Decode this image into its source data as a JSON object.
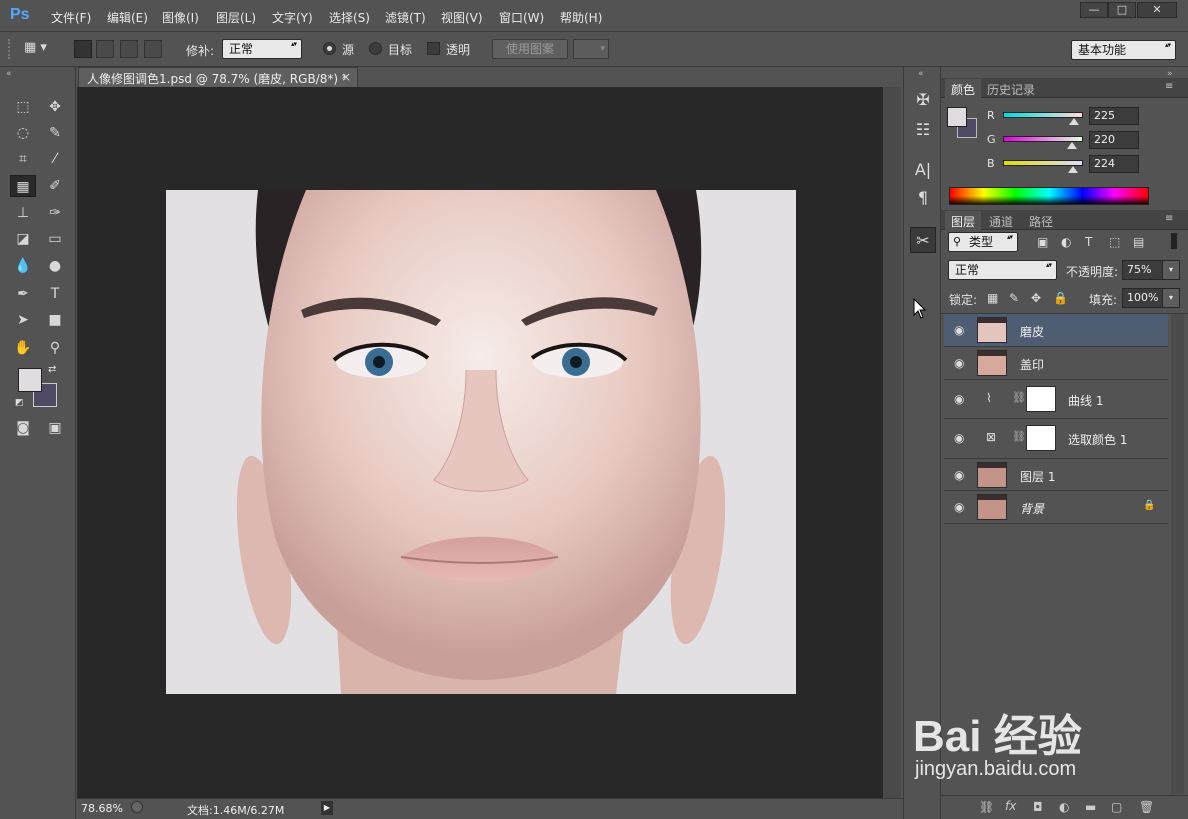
{
  "app": {
    "logo": "Ps"
  },
  "menu": [
    "文件(F)",
    "编辑(E)",
    "图像(I)",
    "图层(L)",
    "文字(Y)",
    "选择(S)",
    "滤镜(T)",
    "视图(V)",
    "窗口(W)",
    "帮助(H)"
  ],
  "window_buttons": {
    "minimize": "—",
    "maximize": "□",
    "close": "✕"
  },
  "options": {
    "patch_label": "修补:",
    "patch_mode": "正常",
    "source_label": "源",
    "target_label": "目标",
    "transparent_label": "透明",
    "use_pattern_label": "使用图案",
    "workspace": "基本功能"
  },
  "document": {
    "tab_title": "人像修图调色1.psd @ 78.7% (磨皮, RGB/8*) *",
    "close_glyph": "×",
    "zoom": "78.68%",
    "doc_size": "文档:1.46M/6.27M"
  },
  "color_panel": {
    "tabs": [
      "颜色",
      "历史记录"
    ],
    "channels": [
      {
        "label": "R",
        "value": "225",
        "fill_fraction": 0.882,
        "grad": "linear-gradient(90deg,#00dcdc,#ffdcdc)"
      },
      {
        "label": "G",
        "value": "220",
        "fill_fraction": 0.863,
        "grad": "linear-gradient(90deg,#e100e0,#e1ffe0)"
      },
      {
        "label": "B",
        "value": "224",
        "fill_fraction": 0.878,
        "grad": "linear-gradient(90deg,#e1dc00,#e1dcff)"
      }
    ],
    "fg_color": "#e1dce0",
    "bg_color": "#4e4a64"
  },
  "layers_panel": {
    "tabs": [
      "图层",
      "通道",
      "路径"
    ],
    "filter_kind": "类型",
    "blend_mode": "正常",
    "opacity_label": "不透明度:",
    "opacity": "75%",
    "lock_label": "锁定:",
    "fill_label": "填充:",
    "fill": "100%",
    "layers": [
      {
        "name": "磨皮",
        "type": "pixel",
        "selected": true
      },
      {
        "name": "盖印",
        "type": "pixel",
        "selected": false
      },
      {
        "name": "曲线 1",
        "type": "adjust-curves",
        "selected": false
      },
      {
        "name": "选取颜色 1",
        "type": "adjust-selective",
        "selected": false
      },
      {
        "name": "图层 1",
        "type": "pixel",
        "selected": false
      },
      {
        "name": "背景",
        "type": "background",
        "selected": false,
        "locked": true
      }
    ]
  },
  "watermark": {
    "brand": "Bai 经验",
    "url": "jingyan.baidu.com"
  }
}
